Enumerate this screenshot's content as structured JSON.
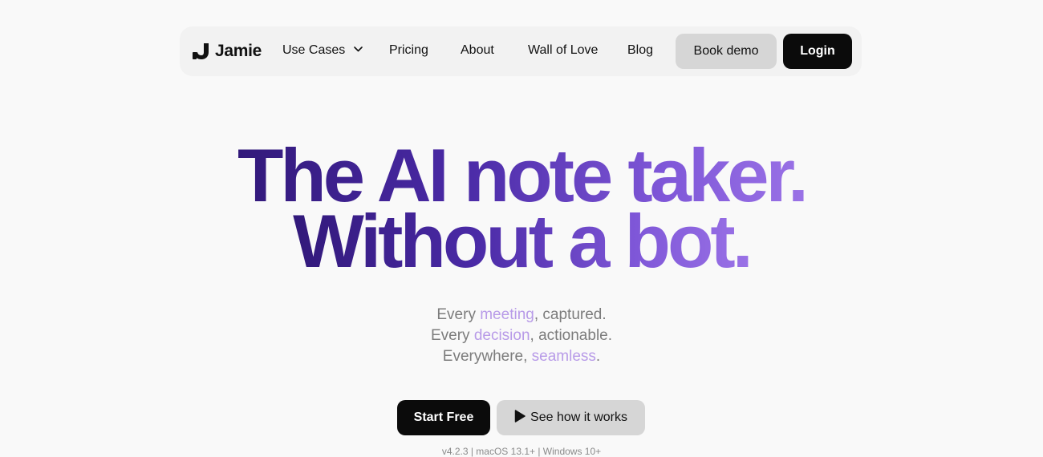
{
  "nav": {
    "brand": "Jamie",
    "items": [
      {
        "label": "Use Cases"
      },
      {
        "label": "Pricing"
      },
      {
        "label": "About"
      },
      {
        "label": "Wall of Love"
      },
      {
        "label": "Blog"
      }
    ],
    "book_demo": "Book demo",
    "login": "Login"
  },
  "hero": {
    "headline_line1": "The AI note taker.",
    "headline_line2": "Without a bot.",
    "sub": [
      {
        "pre": "Every ",
        "hl": "meeting",
        "post": ", captured."
      },
      {
        "pre": "Every ",
        "hl": "decision",
        "post": ", actionable."
      },
      {
        "pre": "Everywhere, ",
        "hl": "seamless",
        "post": "."
      }
    ],
    "start_free": "Start Free",
    "see_how": "See how it works",
    "versions": "v4.2.3 | macOS 13.1+ | Windows 10+"
  },
  "colors": {
    "accent_dark": "#32197a",
    "accent_light": "#9a72e6",
    "highlight": "#b89be8"
  },
  "icons": [
    "jamie-logo-icon",
    "chevron-down-icon",
    "play-icon"
  ]
}
